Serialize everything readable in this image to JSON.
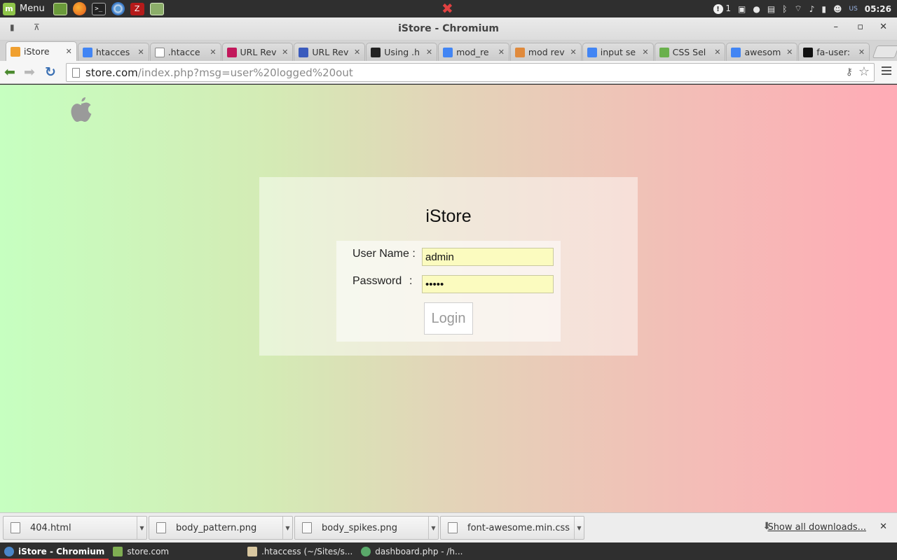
{
  "system_panel": {
    "menu_label": "Menu",
    "launchers": [
      "files-icon",
      "firefox-icon",
      "terminal-icon",
      "chromium-icon",
      "filezilla-icon",
      "notes-icon"
    ],
    "update_count": "1",
    "keyboard_layout": "US",
    "clock": "05:26"
  },
  "window": {
    "title": "iStore - Chromium"
  },
  "tabs": [
    {
      "label": "iStore",
      "active": true,
      "favicon_color": "#f0a030"
    },
    {
      "label": "htacces",
      "active": false,
      "favicon_color": "#4285f4"
    },
    {
      "label": ".htacce",
      "active": false,
      "favicon_color": "#ffffff"
    },
    {
      "label": "URL Rev",
      "active": false,
      "favicon_color": "#c2185b"
    },
    {
      "label": "URL Rev",
      "active": false,
      "favicon_color": "#3b5bbd"
    },
    {
      "label": "Using .h",
      "active": false,
      "favicon_color": "#222222"
    },
    {
      "label": "mod_re",
      "active": false,
      "favicon_color": "#4285f4"
    },
    {
      "label": "mod rev",
      "active": false,
      "favicon_color": "#e08a3c"
    },
    {
      "label": "input se",
      "active": false,
      "favicon_color": "#4285f4"
    },
    {
      "label": "CSS Sel",
      "active": false,
      "favicon_color": "#6ab04c"
    },
    {
      "label": "awesom",
      "active": false,
      "favicon_color": "#4285f4"
    },
    {
      "label": "fa-user:",
      "active": false,
      "favicon_color": "#111111"
    }
  ],
  "toolbar": {
    "url_host": "store.com",
    "url_path": "/index.php?msg=user%20logged%20out"
  },
  "login": {
    "title": "iStore",
    "username_label": "User Name :",
    "password_label": "Password",
    "password_colon": ":",
    "username_value": "admin",
    "password_value": "•••••",
    "login_button": "Login"
  },
  "downloads": {
    "items": [
      "404.html",
      "body_pattern.png",
      "body_spikes.png",
      "font-awesome.min.css"
    ],
    "show_all": "Show all downloads..."
  },
  "taskbar": {
    "items": [
      {
        "label": "iStore - Chromium",
        "active": true
      },
      {
        "label": "store.com",
        "active": false
      },
      {
        "label": ".htaccess (~/Sites/s...",
        "active": false
      },
      {
        "label": "dashboard.php - /h...",
        "active": false
      }
    ]
  }
}
